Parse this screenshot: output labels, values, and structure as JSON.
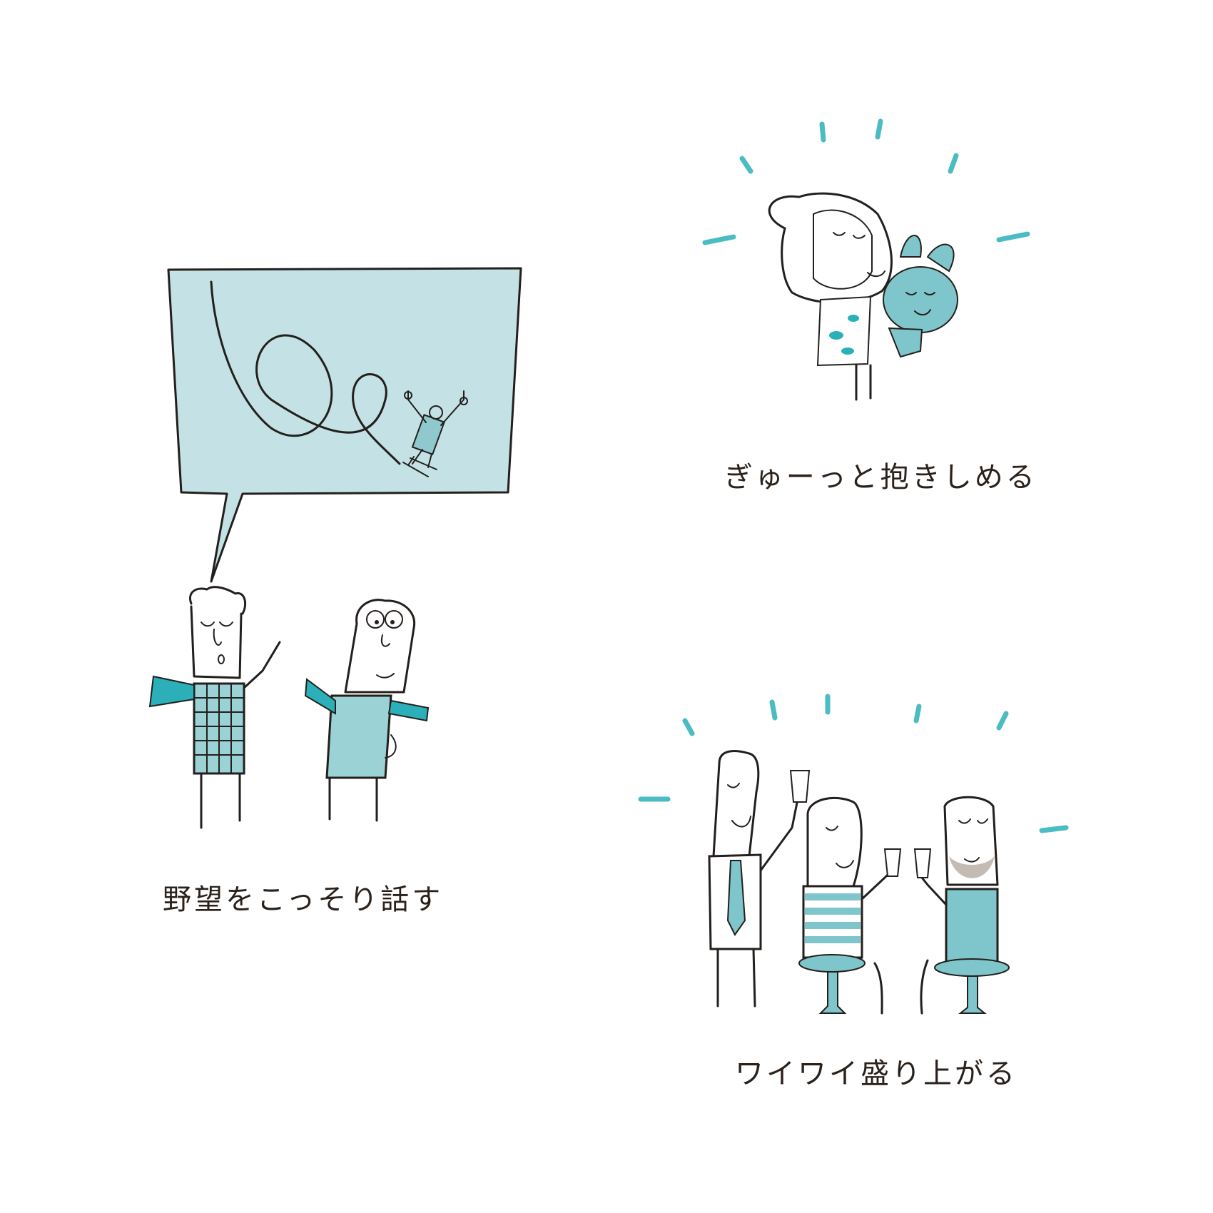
{
  "captions": {
    "whisper_dreams": "野望をこっそり話す",
    "hug_tightly": "ぎゅーっと抱きしめる",
    "lively_party": "ワイワイ盛り上がる"
  },
  "colors": {
    "accent": "#2bb0b9",
    "bubble_fill": "#c4e2e5",
    "shirt_fill": "#9bd2d6",
    "ink": "#231f1c",
    "background": "#ffffff"
  }
}
